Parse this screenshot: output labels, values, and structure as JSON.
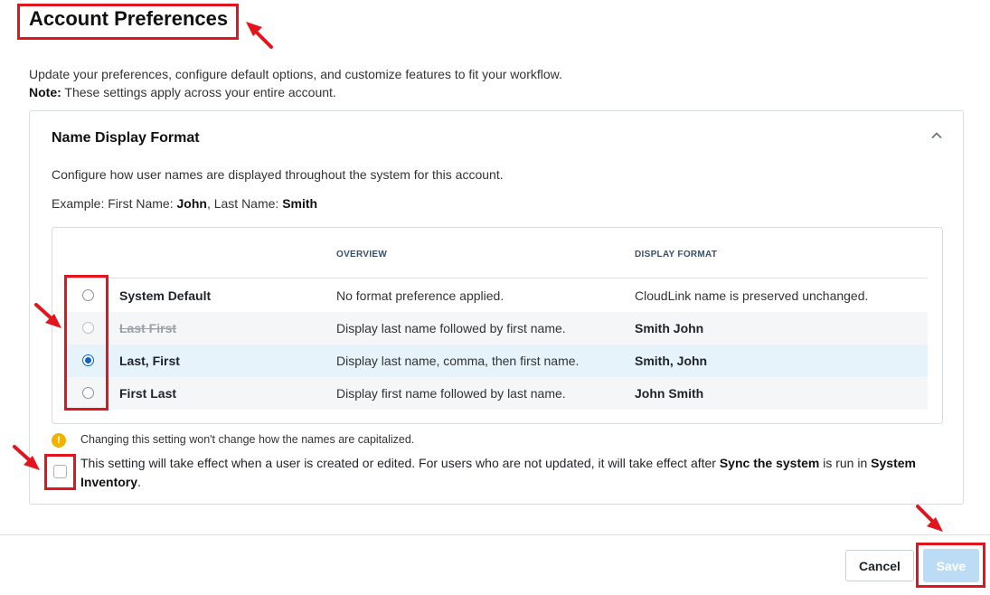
{
  "page": {
    "title": "Account Preferences",
    "description": "Update your preferences, configure default options, and customize features to fit your workflow.",
    "note_label": "Note:",
    "note_text": " These settings apply across your entire account."
  },
  "section": {
    "title": "Name Display Format",
    "description": "Configure how user names are displayed throughout the system for this account.",
    "example_prefix": "Example: First Name: ",
    "example_first": "John",
    "example_middle": ", Last Name: ",
    "example_last": "Smith",
    "columns": {
      "overview": "OVERVIEW",
      "display_format": "DISPLAY FORMAT"
    },
    "rows": [
      {
        "name": "System Default",
        "overview": "No format preference applied.",
        "format": "CloudLink name is preserved unchanged."
      },
      {
        "name": "Last First",
        "overview": "Display last name followed by first name.",
        "format": "Smith John"
      },
      {
        "name": "Last, First",
        "overview": "Display last name, comma, then first name.",
        "format": "Smith, John"
      },
      {
        "name": "First Last",
        "overview": "Display first name followed by last name.",
        "format": "John Smith"
      }
    ],
    "selected_index": 2,
    "warning_text": "Changing this setting won't change how the names are capitalized.",
    "checkbox_text_1": "This setting will take effect when a user is created or edited. For users who are not updated, it will take effect after ",
    "checkbox_bold_1": "Sync the system",
    "checkbox_text_2": " is run in ",
    "checkbox_bold_2": "System Inventory",
    "checkbox_text_3": "."
  },
  "footer": {
    "cancel_label": "Cancel",
    "save_label": "Save"
  },
  "colors": {
    "accent": "#0b63ce",
    "annotation": "#e2141d",
    "save_disabled": "#bcdcf5"
  }
}
